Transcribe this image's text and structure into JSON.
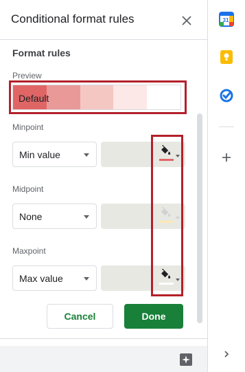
{
  "panel": {
    "title": "Conditional format rules",
    "section_heading": "Format rules",
    "preview": {
      "label": "Preview",
      "text": "Default",
      "gradient_colors": [
        "#e06666",
        "#ea9999",
        "#f4c7c3",
        "#fce8e6",
        "#ffffff"
      ]
    },
    "minpoint": {
      "label": "Minpoint",
      "type": "Min value",
      "value": "",
      "color": "#e06666"
    },
    "midpoint": {
      "label": "Midpoint",
      "type": "None",
      "value": "",
      "color": "#fce8b2"
    },
    "maxpoint": {
      "label": "Maxpoint",
      "type": "Max value",
      "value": "",
      "color": "#ffffff"
    },
    "buttons": {
      "cancel": "Cancel",
      "done": "Done"
    }
  },
  "side_panel": {
    "calendar_day": "31",
    "icons": [
      "calendar-icon",
      "keep-icon",
      "tasks-icon",
      "add-icon",
      "expand-icon"
    ]
  },
  "colors": {
    "accent_green": "#188038",
    "highlight_red": "#b3202a"
  }
}
